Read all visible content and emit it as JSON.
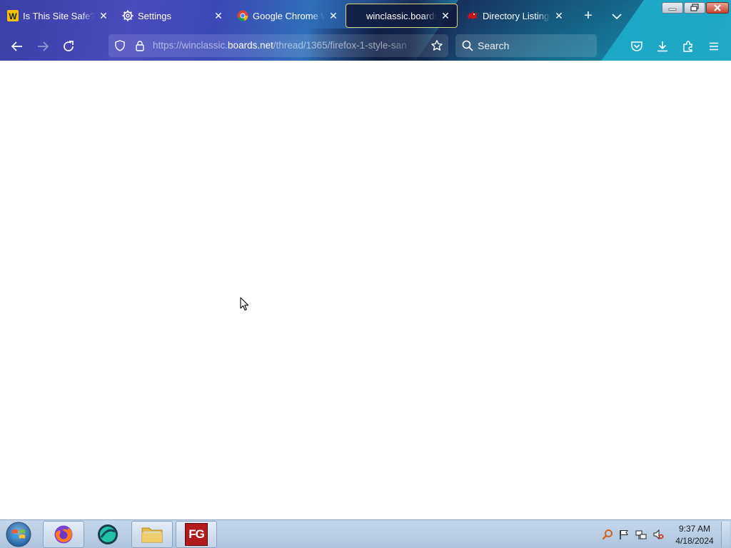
{
  "browser": {
    "tabs": [
      {
        "title": "Is This Site Safe? Ho",
        "icon": "website-checker-icon",
        "active": false
      },
      {
        "title": "Settings",
        "icon": "gear-icon",
        "active": false
      },
      {
        "title": "Google Chrome We",
        "icon": "chrome-logo-icon",
        "active": false
      },
      {
        "title": "winclassic.boards.n",
        "icon": "none",
        "active": true
      },
      {
        "title": "Directory Listing: /",
        "icon": "red-dragon-icon",
        "active": false
      }
    ],
    "tab_close_glyph": "✕",
    "new_tab_glyph": "+",
    "url": {
      "scheme": "https://",
      "subdomain": "winclassic.",
      "host": "boards.net",
      "path": "/thread/1365/firefox-1-style-san"
    },
    "search_placeholder": "Search"
  },
  "taskbar": {
    "apps": [
      {
        "name": "Firefox",
        "icon": "firefox-icon",
        "pressed": true
      },
      {
        "name": "Spotify-like",
        "icon": "teal-circle-app-icon",
        "pressed": false
      },
      {
        "name": "File Explorer",
        "icon": "folder-icon",
        "pressed": true
      },
      {
        "name": "FG",
        "icon": "fg-app-icon",
        "pressed": true,
        "label": "FG"
      }
    ],
    "clock": {
      "time": "9:37 AM",
      "date": "4/18/2024"
    }
  },
  "colors": {
    "tab_active_border": "#d8d27a",
    "page_background": "#ffffff",
    "taskbar": "#bcd0e6"
  }
}
